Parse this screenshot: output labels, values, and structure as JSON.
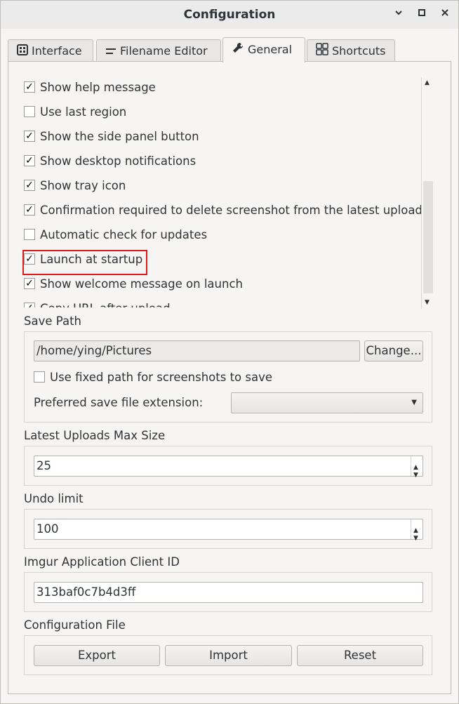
{
  "window": {
    "title": "Configuration",
    "minimize_glyph": "⌃",
    "maximize_glyph": "▪",
    "close_glyph": "✕"
  },
  "tabs": [
    {
      "label": "Interface",
      "icon": "interface-icon"
    },
    {
      "label": "Filename Editor",
      "icon": "filename-editor-icon"
    },
    {
      "label": "General",
      "icon": "wrench-icon",
      "active": true
    },
    {
      "label": "Shortcuts",
      "icon": "shortcuts-icon"
    }
  ],
  "general": {
    "options": [
      {
        "label": "Show help message",
        "checked": true
      },
      {
        "label": "Use last region",
        "checked": false
      },
      {
        "label": "Show the side panel button",
        "checked": true
      },
      {
        "label": "Show desktop notifications",
        "checked": true
      },
      {
        "label": "Show tray icon",
        "checked": true
      },
      {
        "label": "Confirmation required to delete screenshot from the latest uploads",
        "checked": true
      },
      {
        "label": "Automatic check for updates",
        "checked": false
      },
      {
        "label": "Launch at startup",
        "checked": true,
        "highlighted": true
      },
      {
        "label": "Show welcome message on launch",
        "checked": true
      },
      {
        "label": "Copy URL after upload",
        "checked": true
      }
    ],
    "save_path": {
      "label": "Save Path",
      "path_value": "/home/ying/Pictures",
      "change_button": "Change...",
      "fixed_path_label": "Use fixed path for screenshots to save",
      "fixed_path_checked": false,
      "extension_label": "Preferred save file extension:",
      "extension_value": ""
    },
    "latest_uploads": {
      "label": "Latest Uploads Max Size",
      "value": "25"
    },
    "undo": {
      "label": "Undo limit",
      "value": "100"
    },
    "imgur": {
      "label": "Imgur Application Client ID",
      "value": "313baf0c7b4d3ff"
    },
    "config_file": {
      "label": "Configuration File",
      "export": "Export",
      "import": "Import",
      "reset": "Reset"
    }
  },
  "colors": {
    "highlight": "#e01b1b",
    "background": "#f6f5f4"
  }
}
